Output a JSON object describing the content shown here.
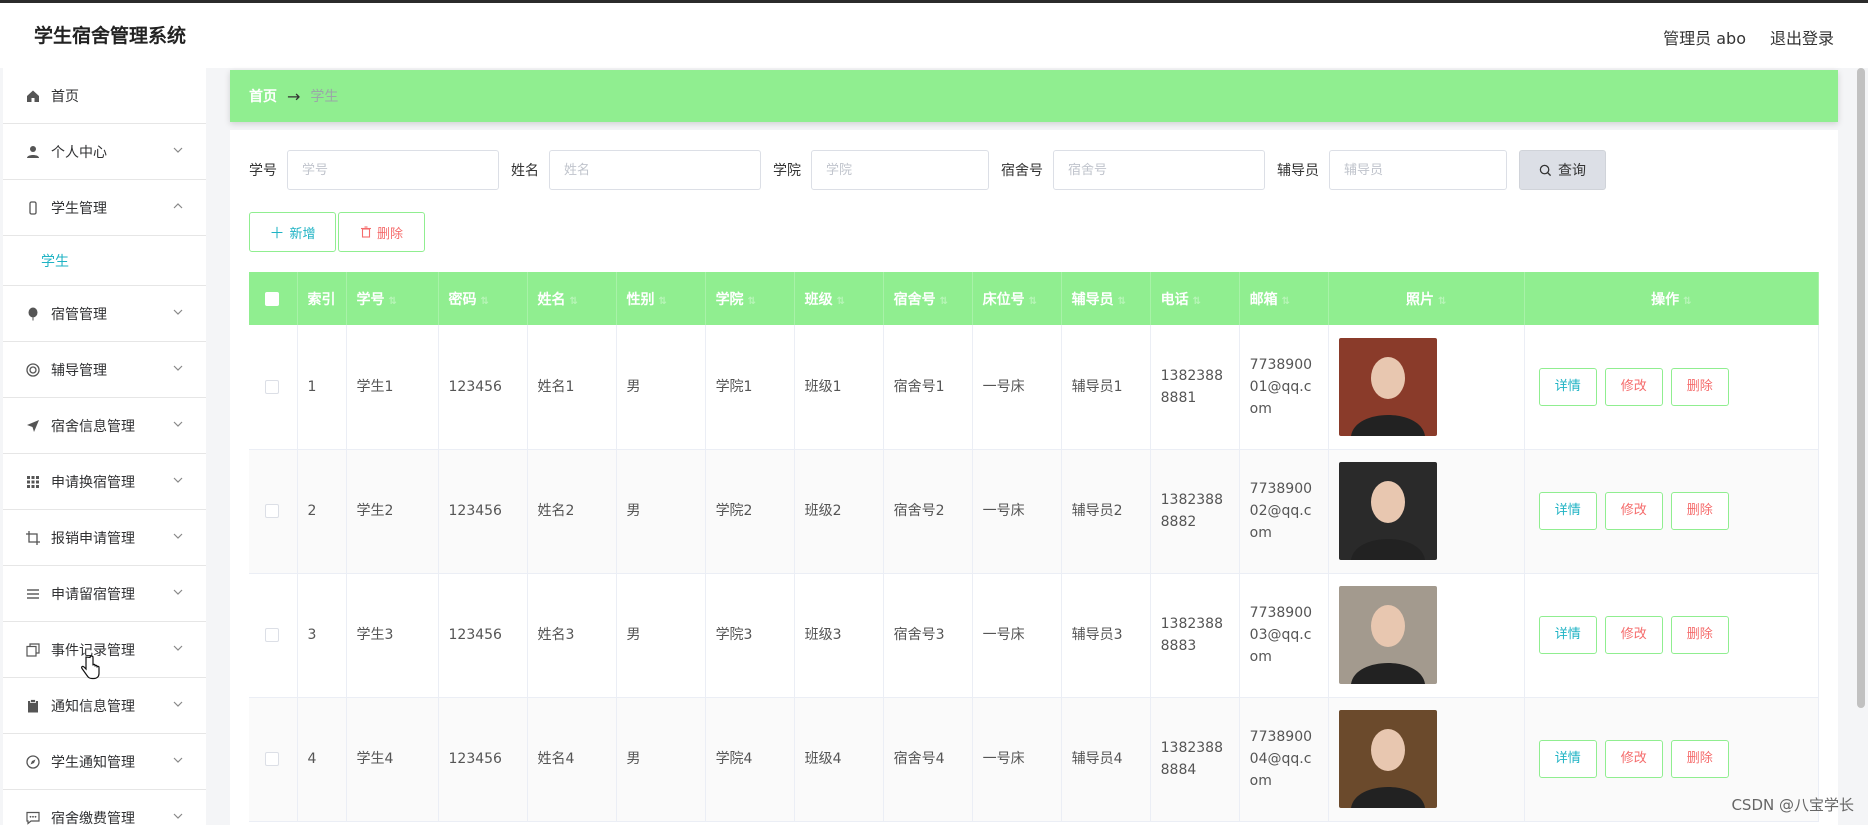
{
  "app": {
    "title": "学生宿舍管理系统"
  },
  "header": {
    "user_label": "管理员 abo",
    "logout_label": "退出登录"
  },
  "sidebar": {
    "items": [
      {
        "label": "首页",
        "icon": "home-icon",
        "has_chevron": false
      },
      {
        "label": "个人中心",
        "icon": "user-icon",
        "has_chevron": true
      },
      {
        "label": "学生管理",
        "icon": "phone-icon",
        "has_chevron": true,
        "expanded": true,
        "sub": [
          "学生"
        ]
      },
      {
        "label": "宿管管理",
        "icon": "balloon-icon",
        "has_chevron": true
      },
      {
        "label": "辅导管理",
        "icon": "target-icon",
        "has_chevron": true
      },
      {
        "label": "宿舍信息管理",
        "icon": "send-icon",
        "has_chevron": true
      },
      {
        "label": "申请换宿管理",
        "icon": "grid-icon",
        "has_chevron": true
      },
      {
        "label": "报销申请管理",
        "icon": "crop-icon",
        "has_chevron": true
      },
      {
        "label": "申请留宿管理",
        "icon": "list-icon",
        "has_chevron": true
      },
      {
        "label": "事件记录管理",
        "icon": "copy-icon",
        "has_chevron": true
      },
      {
        "label": "通知信息管理",
        "icon": "clipboard-icon",
        "has_chevron": true
      },
      {
        "label": "学生通知管理",
        "icon": "compass-icon",
        "has_chevron": true
      },
      {
        "label": "宿舍缴费管理",
        "icon": "chat-icon",
        "has_chevron": true
      }
    ]
  },
  "breadcrumb": {
    "home": "首页",
    "arrow": "→",
    "current": "学生"
  },
  "search": {
    "fields": [
      {
        "label": "学号",
        "placeholder": "学号"
      },
      {
        "label": "姓名",
        "placeholder": "姓名"
      },
      {
        "label": "学院",
        "placeholder": "学院"
      },
      {
        "label": "宿舍号",
        "placeholder": "宿舍号"
      },
      {
        "label": "辅导员",
        "placeholder": "辅导员"
      }
    ],
    "query_label": "查询"
  },
  "actions": {
    "add_label": "新增",
    "delete_label": "删除"
  },
  "table": {
    "columns": [
      "索引",
      "学号",
      "密码",
      "姓名",
      "性别",
      "学院",
      "班级",
      "宿舍号",
      "床位号",
      "辅导员",
      "电话",
      "邮箱",
      "照片",
      "操作"
    ],
    "rows": [
      {
        "index": "1",
        "sid": "学生1",
        "pwd": "123456",
        "name": "姓名1",
        "gender": "男",
        "college": "学院1",
        "class": "班级1",
        "dorm": "宿舍号1",
        "bed": "一号床",
        "counselor": "辅导员1",
        "phone": "13823888881",
        "email": "773890001@qq.com",
        "photo_color": "#8a3b2a"
      },
      {
        "index": "2",
        "sid": "学生2",
        "pwd": "123456",
        "name": "姓名2",
        "gender": "男",
        "college": "学院2",
        "class": "班级2",
        "dorm": "宿舍号2",
        "bed": "一号床",
        "counselor": "辅导员2",
        "phone": "13823888882",
        "email": "773890002@qq.com",
        "photo_color": "#2a2a2a"
      },
      {
        "index": "3",
        "sid": "学生3",
        "pwd": "123456",
        "name": "姓名3",
        "gender": "男",
        "college": "学院3",
        "class": "班级3",
        "dorm": "宿舍号3",
        "bed": "一号床",
        "counselor": "辅导员3",
        "phone": "13823888883",
        "email": "773890003@qq.com",
        "photo_color": "#a39a8e"
      },
      {
        "index": "4",
        "sid": "学生4",
        "pwd": "123456",
        "name": "姓名4",
        "gender": "男",
        "college": "学院4",
        "class": "班级4",
        "dorm": "宿舍号4",
        "bed": "一号床",
        "counselor": "辅导员4",
        "phone": "13823888884",
        "email": "773890004@qq.com",
        "photo_color": "#6b4a2c"
      }
    ],
    "row_actions": {
      "detail": "详情",
      "edit": "修改",
      "delete": "删除"
    }
  },
  "watermark": "CSDN @八宝学长",
  "colors": {
    "accent_green": "#90ee90",
    "teal_text": "#1fb3c4",
    "red_text": "#f56c6c"
  }
}
